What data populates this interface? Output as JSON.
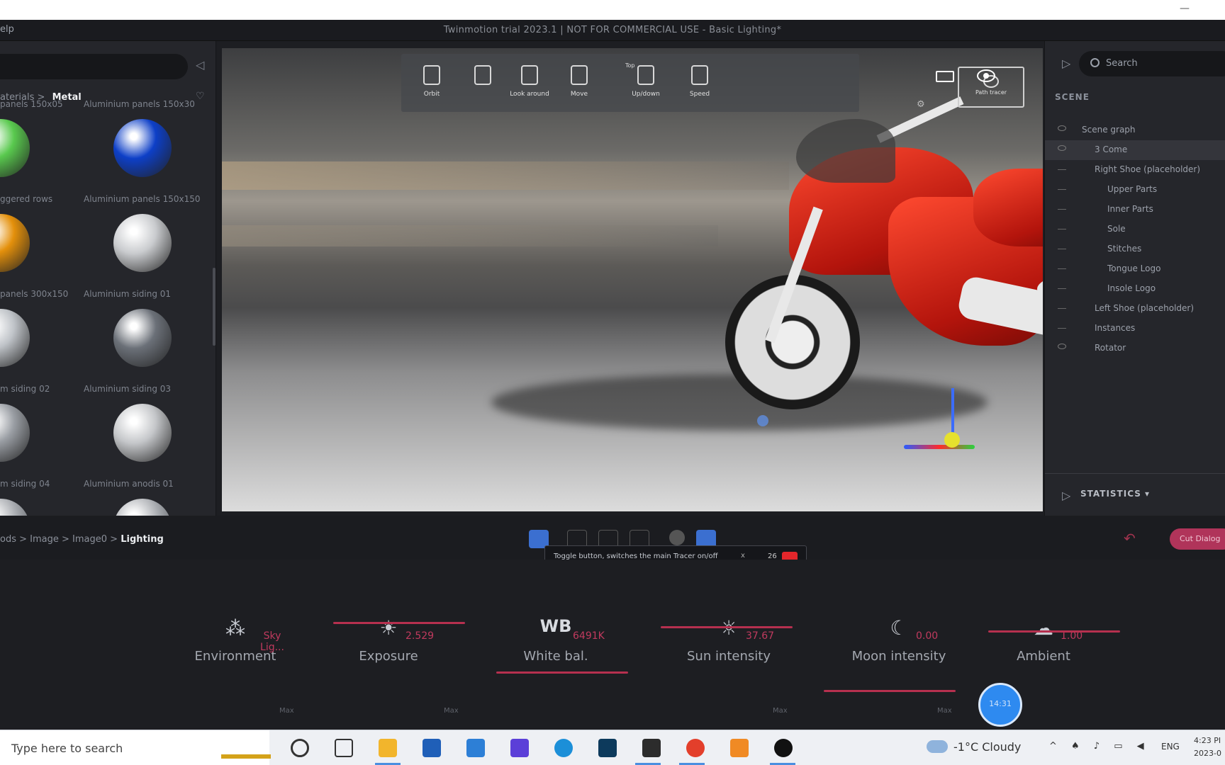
{
  "os": {
    "minimize_glyph": "—"
  },
  "app": {
    "menu_help": "elp",
    "title": "Twinmotion trial 2023.1 | NOT FOR COMMERCIAL USE - Basic Lighting*"
  },
  "library": {
    "breadcrumb_parent": "aterials",
    "breadcrumb_sep": ">",
    "breadcrumb_current": "Metal",
    "materials": [
      {
        "label": "panels 150x05",
        "color": "#59c94e"
      },
      {
        "label": "Aluminium panels 150x30",
        "color": "#0d3fc7"
      },
      {
        "label": "ggered rows",
        "color": "#e4900b"
      },
      {
        "label": "Aluminium panels 150x150",
        "color": "#c9cbce"
      },
      {
        "label": "panels 300x150",
        "color": "#bfc3c8"
      },
      {
        "label": "Aluminium siding 01",
        "color": "#6b7078"
      },
      {
        "label": "m siding 02",
        "color": "#9a9ea4"
      },
      {
        "label": "Aluminium siding 03",
        "color": "#c4c6c9"
      },
      {
        "label": "m siding 04",
        "color": ""
      },
      {
        "label": "Aluminium anodis 01",
        "color": ""
      }
    ]
  },
  "viewport": {
    "top_label": "Top",
    "tools": [
      {
        "label": "Orbit",
        "icon": "orbit-icon"
      },
      {
        "label": "",
        "icon": "camera-icon"
      },
      {
        "label": "Look around",
        "icon": "look-around-icon"
      },
      {
        "label": "Move",
        "icon": "move-icon"
      },
      {
        "label": "Up/down",
        "icon": "up-down-icon"
      },
      {
        "label": "Speed",
        "icon": "speed-icon"
      }
    ],
    "render_button": "Path tracer",
    "frame_icon": "aspect-ratio-icon",
    "eye_icon": "visibility-icon"
  },
  "scene_panel": {
    "search_placeholder": "Search",
    "section_label": "SCENE",
    "rows": [
      {
        "text": "Scene graph",
        "indent": 1,
        "visible": true,
        "selected": false
      },
      {
        "text": "3 Come",
        "indent": 2,
        "visible": true,
        "selected": true
      },
      {
        "text": "Right Shoe (placeholder)",
        "indent": 2,
        "visible": false,
        "selected": false
      },
      {
        "text": "Upper Parts",
        "indent": 3,
        "visible": false,
        "selected": false
      },
      {
        "text": "Inner Parts",
        "indent": 3,
        "visible": false,
        "selected": false
      },
      {
        "text": "Sole",
        "indent": 3,
        "visible": false,
        "selected": false
      },
      {
        "text": "Stitches",
        "indent": 3,
        "visible": false,
        "selected": false
      },
      {
        "text": "Tongue Logo",
        "indent": 3,
        "visible": false,
        "selected": false
      },
      {
        "text": "Insole Logo",
        "indent": 3,
        "visible": false,
        "selected": false
      },
      {
        "text": "Left Shoe (placeholder)",
        "indent": 2,
        "visible": false,
        "selected": false
      },
      {
        "text": "Instances",
        "indent": 2,
        "visible": false,
        "selected": false
      },
      {
        "text": "Rotator",
        "indent": 2,
        "visible": true,
        "selected": false
      }
    ],
    "statistics_label": "STATISTICS ▾"
  },
  "bottom_bar": {
    "crumbs": [
      "ods",
      "Image",
      "Image0",
      "Lighting"
    ],
    "tooltip_text": "Toggle button, switches the main Tracer on/off",
    "tooltip_close": "x",
    "tooltip_num": "26",
    "pill_label": "Cut Dialog"
  },
  "lighting": {
    "items": [
      {
        "label": "Environment",
        "value": "Sky Lig...",
        "icon": "environment-icon"
      },
      {
        "label": "Exposure",
        "value": "2.529",
        "icon": "exposure-icon"
      },
      {
        "label": "White bal.",
        "value": "6491K",
        "icon": "white-balance-icon",
        "wb": "WB"
      },
      {
        "label": "Sun intensity",
        "value": "37.67",
        "icon": "sun-icon"
      },
      {
        "label": "Moon intensity",
        "value": "0.00",
        "icon": "moon-icon"
      },
      {
        "label": "Ambient",
        "value": "1.00",
        "icon": "ambient-icon"
      }
    ],
    "small_labels": [
      "Max",
      "Max",
      "Max",
      "Max"
    ],
    "fab_label": "14:31"
  },
  "taskbar": {
    "search_placeholder": "Type here to search",
    "weather": "-1°C  Cloudy",
    "tray": "^ ♠ ♪ ▭ ◀",
    "lang": "ENG",
    "time": "4:23 PI",
    "date": "2023-0"
  }
}
